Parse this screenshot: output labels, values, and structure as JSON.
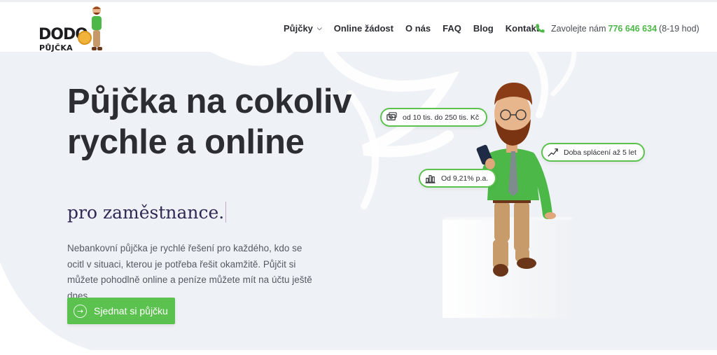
{
  "brand": {
    "logo_text": "DODO",
    "logo_sub": "PŮJČKA",
    "accent": "#5cc24f"
  },
  "nav": {
    "items": [
      {
        "label": "Půjčky",
        "has_dropdown": true
      },
      {
        "label": "Online žádost",
        "has_dropdown": false
      },
      {
        "label": "O nás",
        "has_dropdown": false
      },
      {
        "label": "FAQ",
        "has_dropdown": false
      },
      {
        "label": "Blog",
        "has_dropdown": false
      },
      {
        "label": "Kontakt",
        "has_dropdown": false
      }
    ],
    "dropdown_icon": "chevron-down-icon"
  },
  "phone": {
    "prefix": "Zavolejte nám",
    "number": "776 646 634",
    "hours": "(8-19 hod)",
    "icon": "phone-icon"
  },
  "hero": {
    "title": "Půjčka na cokoliv rychle a online",
    "subtitle": "pro zaměstnance.",
    "lead": "Nebankovní půjčka je rychlé řešení pro každého, kdo se ocitl v situaci, kterou je potřeba řešit okamžitě. Půjčit si můžete pohodlně online a peníze můžete mít na účtu ještě dnes.",
    "cta_label": "Sjednat si půjčku",
    "cta_icon": "arrow-right-icon"
  },
  "badges": {
    "amount": {
      "label": "od 10 tis. do 250 tis. Kč",
      "icon": "money-icon"
    },
    "term": {
      "label": "Doba splácení až 5 let",
      "icon": "growth-arrow-icon"
    },
    "rate": {
      "label": "Od 9,21% p.a.",
      "icon": "bar-chart-icon"
    }
  }
}
